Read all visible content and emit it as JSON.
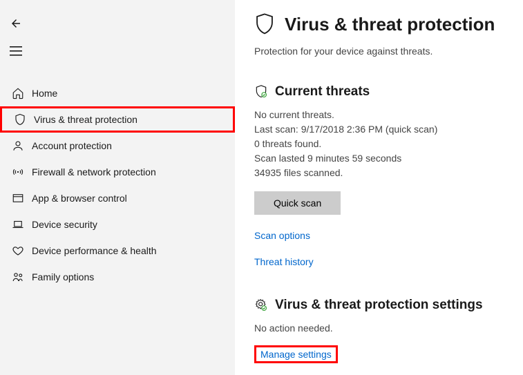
{
  "sidebar": {
    "items": [
      {
        "label": "Home"
      },
      {
        "label": "Virus & threat protection"
      },
      {
        "label": "Account protection"
      },
      {
        "label": "Firewall & network protection"
      },
      {
        "label": "App & browser control"
      },
      {
        "label": "Device security"
      },
      {
        "label": "Device performance & health"
      },
      {
        "label": "Family options"
      }
    ]
  },
  "page": {
    "title": "Virus & threat protection",
    "subtitle": "Protection for your device against threats."
  },
  "current_threats": {
    "title": "Current threats",
    "line1": "No current threats.",
    "line2": "Last scan: 9/17/2018 2:36 PM (quick scan)",
    "line3": "0 threats found.",
    "line4": "Scan lasted 9 minutes 59 seconds",
    "line5": "34935 files scanned.",
    "scan_button": "Quick scan",
    "scan_options_link": "Scan options",
    "threat_history_link": "Threat history"
  },
  "settings": {
    "title": "Virus & threat protection settings",
    "line1": "No action needed.",
    "manage_link": "Manage settings"
  }
}
